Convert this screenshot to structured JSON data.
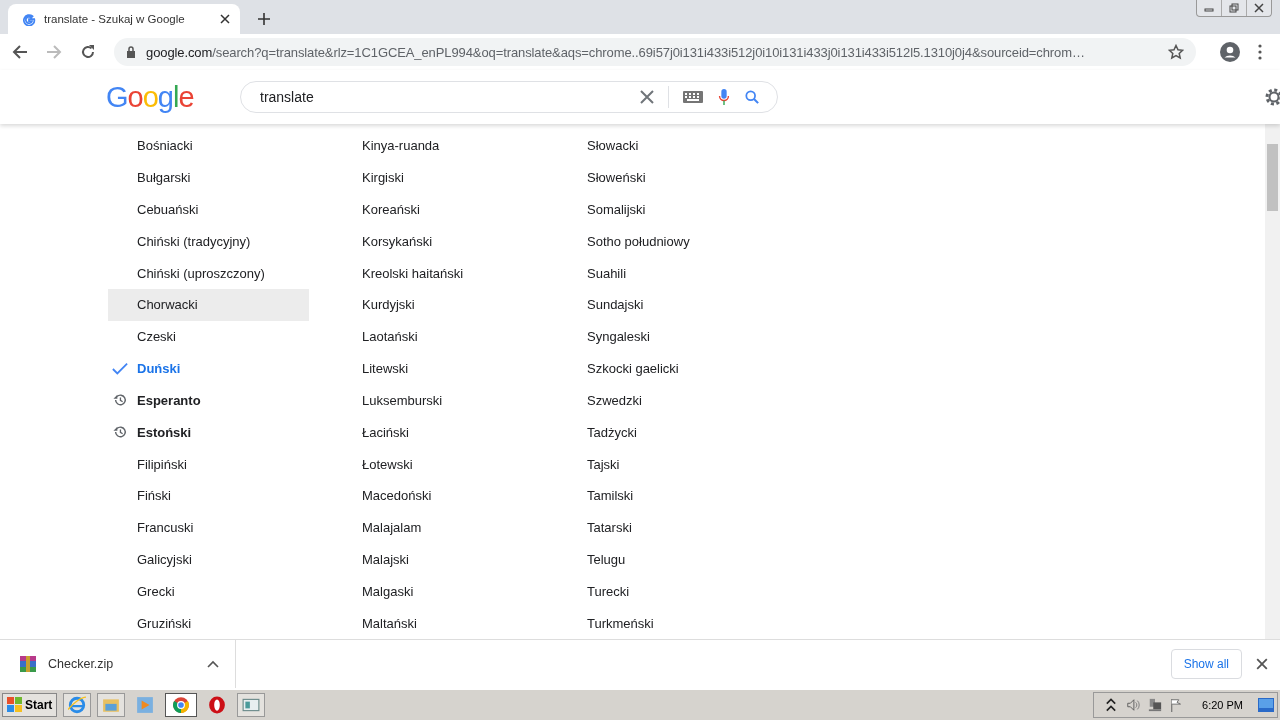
{
  "browser": {
    "tab_title": "translate - Szukaj w Google",
    "url_host": "google.com",
    "url_path": "/search?q=translate&rlz=1C1GCEA_enPL994&oq=translate&aqs=chrome..69i57j0i131i433i512j0i10i131i433j0i131i433i512l5.1310j0j4&sourceid=chrom…"
  },
  "search": {
    "logo": "Google",
    "value": "translate"
  },
  "languages": [
    [
      {
        "name": "Bośniacki",
        "selected": false,
        "recent": false,
        "highlighted": false
      },
      {
        "name": "Bułgarski",
        "selected": false,
        "recent": false,
        "highlighted": false
      },
      {
        "name": "Cebuański",
        "selected": false,
        "recent": false,
        "highlighted": false
      },
      {
        "name": "Chiński (tradycyjny)",
        "selected": false,
        "recent": false,
        "highlighted": false
      },
      {
        "name": "Chiński (uproszczony)",
        "selected": false,
        "recent": false,
        "highlighted": false
      },
      {
        "name": "Chorwacki",
        "selected": false,
        "recent": false,
        "highlighted": true
      },
      {
        "name": "Czeski",
        "selected": false,
        "recent": false,
        "highlighted": false
      },
      {
        "name": "Duński",
        "selected": true,
        "recent": false,
        "highlighted": false
      },
      {
        "name": "Esperanto",
        "selected": false,
        "recent": true,
        "highlighted": false
      },
      {
        "name": "Estoński",
        "selected": false,
        "recent": true,
        "highlighted": false
      },
      {
        "name": "Filipiński",
        "selected": false,
        "recent": false,
        "highlighted": false
      },
      {
        "name": "Fiński",
        "selected": false,
        "recent": false,
        "highlighted": false
      },
      {
        "name": "Francuski",
        "selected": false,
        "recent": false,
        "highlighted": false
      },
      {
        "name": "Galicyjski",
        "selected": false,
        "recent": false,
        "highlighted": false
      },
      {
        "name": "Grecki",
        "selected": false,
        "recent": false,
        "highlighted": false
      },
      {
        "name": "Gruziński",
        "selected": false,
        "recent": false,
        "highlighted": false
      }
    ],
    [
      {
        "name": "Kinya-ruanda",
        "selected": false,
        "recent": false,
        "highlighted": false
      },
      {
        "name": "Kirgiski",
        "selected": false,
        "recent": false,
        "highlighted": false
      },
      {
        "name": "Koreański",
        "selected": false,
        "recent": false,
        "highlighted": false
      },
      {
        "name": "Korsykański",
        "selected": false,
        "recent": false,
        "highlighted": false
      },
      {
        "name": "Kreolski haitański",
        "selected": false,
        "recent": false,
        "highlighted": false
      },
      {
        "name": "Kurdyjski",
        "selected": false,
        "recent": false,
        "highlighted": false
      },
      {
        "name": "Laotański",
        "selected": false,
        "recent": false,
        "highlighted": false
      },
      {
        "name": "Litewski",
        "selected": false,
        "recent": false,
        "highlighted": false
      },
      {
        "name": "Luksemburski",
        "selected": false,
        "recent": false,
        "highlighted": false
      },
      {
        "name": "Łaciński",
        "selected": false,
        "recent": false,
        "highlighted": false
      },
      {
        "name": "Łotewski",
        "selected": false,
        "recent": false,
        "highlighted": false
      },
      {
        "name": "Macedoński",
        "selected": false,
        "recent": false,
        "highlighted": false
      },
      {
        "name": "Malajalam",
        "selected": false,
        "recent": false,
        "highlighted": false
      },
      {
        "name": "Malajski",
        "selected": false,
        "recent": false,
        "highlighted": false
      },
      {
        "name": "Malgaski",
        "selected": false,
        "recent": false,
        "highlighted": false
      },
      {
        "name": "Maltański",
        "selected": false,
        "recent": false,
        "highlighted": false
      }
    ],
    [
      {
        "name": "Słowacki",
        "selected": false,
        "recent": false,
        "highlighted": false
      },
      {
        "name": "Słoweński",
        "selected": false,
        "recent": false,
        "highlighted": false
      },
      {
        "name": "Somalijski",
        "selected": false,
        "recent": false,
        "highlighted": false
      },
      {
        "name": "Sotho południowy",
        "selected": false,
        "recent": false,
        "highlighted": false
      },
      {
        "name": "Suahili",
        "selected": false,
        "recent": false,
        "highlighted": false
      },
      {
        "name": "Sundajski",
        "selected": false,
        "recent": false,
        "highlighted": false
      },
      {
        "name": "Syngaleski",
        "selected": false,
        "recent": false,
        "highlighted": false
      },
      {
        "name": "Szkocki gaelicki",
        "selected": false,
        "recent": false,
        "highlighted": false
      },
      {
        "name": "Szwedzki",
        "selected": false,
        "recent": false,
        "highlighted": false
      },
      {
        "name": "Tadżycki",
        "selected": false,
        "recent": false,
        "highlighted": false
      },
      {
        "name": "Tajski",
        "selected": false,
        "recent": false,
        "highlighted": false
      },
      {
        "name": "Tamilski",
        "selected": false,
        "recent": false,
        "highlighted": false
      },
      {
        "name": "Tatarski",
        "selected": false,
        "recent": false,
        "highlighted": false
      },
      {
        "name": "Telugu",
        "selected": false,
        "recent": false,
        "highlighted": false
      },
      {
        "name": "Turecki",
        "selected": false,
        "recent": false,
        "highlighted": false
      },
      {
        "name": "Turkmeński",
        "selected": false,
        "recent": false,
        "highlighted": false
      }
    ]
  ],
  "downloads": {
    "file": "Checker.zip",
    "show_all": "Show all"
  },
  "taskbar": {
    "start": "Start",
    "clock": "6:20 PM"
  }
}
